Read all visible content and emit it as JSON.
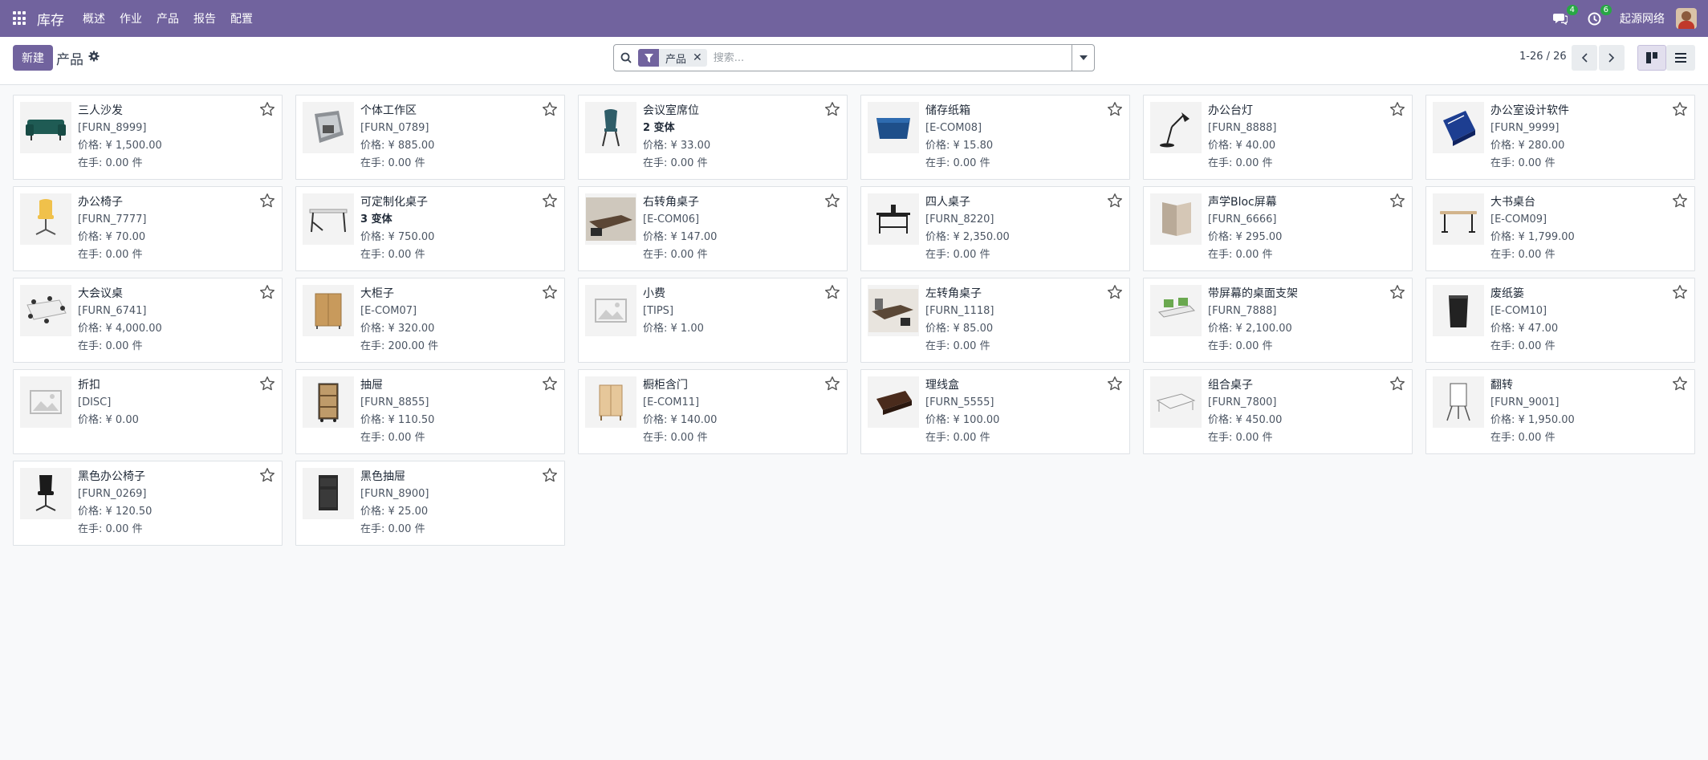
{
  "navbar": {
    "app_name": "库存",
    "menu": [
      "概述",
      "作业",
      "产品",
      "报告",
      "配置"
    ],
    "chat_badge": "4",
    "activity_badge": "6",
    "company": "起源网络"
  },
  "control": {
    "new_label": "新建",
    "title": "产品",
    "facet_label": "产品",
    "search_placeholder": "搜索...",
    "pager": "1-26 / 26"
  },
  "products": [
    {
      "name": "三人沙发",
      "line2": "[FURN_8999]",
      "price": "价格: ¥ 1,500.00",
      "stock": "在手:    0.00 件",
      "icon": "sofa-image"
    },
    {
      "name": "个体工作区",
      "line2": "[FURN_0789]",
      "price": "价格: ¥ 885.00",
      "stock": "在手:    0.00 件",
      "icon": "workspace-image"
    },
    {
      "name": "会议室席位",
      "line2": "2 变体",
      "price": "价格: ¥ 33.00",
      "stock": "在手:    0.00 件",
      "icon": "chair-image",
      "variant": true
    },
    {
      "name": "储存纸箱",
      "line2": "[E-COM08]",
      "price": "价格: ¥ 15.80",
      "stock": "在手:    0.00 件",
      "icon": "box-image"
    },
    {
      "name": "办公台灯",
      "line2": "[FURN_8888]",
      "price": "价格: ¥ 40.00",
      "stock": "在手:    0.00 件",
      "icon": "lamp-image"
    },
    {
      "name": "办公室设计软件",
      "line2": "[FURN_9999]",
      "price": "价格: ¥ 280.00",
      "stock": "在手:    0.00 件",
      "icon": "software-box-image"
    },
    {
      "name": "办公椅子",
      "line2": "[FURN_7777]",
      "price": "价格: ¥ 70.00",
      "stock": "在手:    0.00 件",
      "icon": "office-chair-image"
    },
    {
      "name": "可定制化桌子",
      "line2": "3 变体",
      "price": "价格: ¥ 750.00",
      "stock": "在手:    0.00 件",
      "icon": "desk-image",
      "variant": true
    },
    {
      "name": "右转角桌子",
      "line2": "[E-COM06]",
      "price": "价格: ¥ 147.00",
      "stock": "在手:    0.00 件",
      "icon": "corner-desk-image"
    },
    {
      "name": "四人桌子",
      "line2": "[FURN_8220]",
      "price": "价格: ¥ 2,350.00",
      "stock": "在手:    0.00 件",
      "icon": "four-desk-image"
    },
    {
      "name": "声学Bloc屏幕",
      "line2": "[FURN_6666]",
      "price": "价格: ¥ 295.00",
      "stock": "在手:    0.00 件",
      "icon": "screen-image"
    },
    {
      "name": "大书桌台",
      "line2": "[E-COM09]",
      "price": "价格: ¥ 1,799.00",
      "stock": "在手:    0.00 件",
      "icon": "large-desk-image"
    },
    {
      "name": "大会议桌",
      "line2": "[FURN_6741]",
      "price": "价格: ¥ 4,000.00",
      "stock": "在手:    0.00 件",
      "icon": "meeting-table-image"
    },
    {
      "name": "大柜子",
      "line2": "[E-COM07]",
      "price": "价格: ¥ 320.00",
      "stock": "在手:    200.00 件",
      "icon": "cabinet-image"
    },
    {
      "name": "小费",
      "line2": "[TIPS]",
      "price": "价格: ¥ 1.00",
      "stock": "",
      "icon": "placeholder-image"
    },
    {
      "name": "左转角桌子",
      "line2": "[FURN_1118]",
      "price": "价格: ¥ 85.00",
      "stock": "在手:    0.00 件",
      "icon": "corner-desk-left-image"
    },
    {
      "name": "带屏幕的桌面支架",
      "line2": "[FURN_7888]",
      "price": "价格: ¥ 2,100.00",
      "stock": "在手:    0.00 件",
      "icon": "desk-stand-image"
    },
    {
      "name": "废纸篓",
      "line2": "[E-COM10]",
      "price": "价格: ¥ 47.00",
      "stock": "在手:    0.00 件",
      "icon": "bin-image"
    },
    {
      "name": "折扣",
      "line2": "[DISC]",
      "price": "价格: ¥ 0.00",
      "stock": "",
      "icon": "placeholder-image"
    },
    {
      "name": "抽屉",
      "line2": "[FURN_8855]",
      "price": "价格: ¥ 110.50",
      "stock": "在手:    0.00 件",
      "icon": "drawer-image"
    },
    {
      "name": "橱柜含门",
      "line2": "[E-COM11]",
      "price": "价格: ¥ 140.00",
      "stock": "在手:    0.00 件",
      "icon": "cupboard-image"
    },
    {
      "name": "理线盒",
      "line2": "[FURN_5555]",
      "price": "价格: ¥ 100.00",
      "stock": "在手:    0.00 件",
      "icon": "cable-box-image"
    },
    {
      "name": "组合桌子",
      "line2": "[FURN_7800]",
      "price": "价格: ¥ 450.00",
      "stock": "在手:    0.00 件",
      "icon": "combo-desk-image"
    },
    {
      "name": "翻转",
      "line2": "[FURN_9001]",
      "price": "价格: ¥ 1,950.00",
      "stock": "在手:    0.00 件",
      "icon": "flipchart-image"
    },
    {
      "name": "黑色办公椅子",
      "line2": "[FURN_0269]",
      "price": "价格: ¥ 120.50",
      "stock": "在手:    0.00 件",
      "icon": "black-chair-image"
    },
    {
      "name": "黑色抽屉",
      "line2": "[FURN_8900]",
      "price": "价格: ¥ 25.00",
      "stock": "在手:    0.00 件",
      "icon": "black-drawer-image"
    }
  ],
  "colors": {
    "brand": "#71639e",
    "badge": "#28a745"
  }
}
